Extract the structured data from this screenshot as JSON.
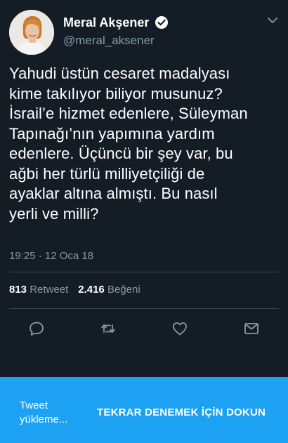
{
  "tweet": {
    "author": {
      "display_name": "Meral Akşener",
      "handle": "@meral_aksener",
      "verified_icon": "verified-badge-icon",
      "avatar": "avatar"
    },
    "body_lines": [
      "Yahudi üstün cesaret madalyası",
      "kime takılıyor biliyor musunuz?",
      "İsrail’e hizmet edenlere, Süleyman",
      "Tapınağı’nın yapımına yardım",
      "edenlere. Üçüncü bir şey var, bu",
      "ağbi her türlü milliyetçiliği de",
      "ayaklar altına almıştı. Bu nasıl",
      "yerli ve milli?"
    ],
    "timestamp": "19:25 · 12 Oca 18",
    "stats": {
      "retweets": "813",
      "retweets_label": "Retweet",
      "likes": "2.416",
      "likes_label": "Beğeni"
    },
    "actions": [
      {
        "name": "reply",
        "icon": "reply-icon"
      },
      {
        "name": "retweet",
        "icon": "retweet-icon"
      },
      {
        "name": "like",
        "icon": "heart-icon"
      },
      {
        "name": "message",
        "icon": "envelope-icon"
      }
    ]
  },
  "banner": {
    "status_lines": [
      "Tweet",
      "yükleme..."
    ],
    "action_label": "TEKRAR DENEMEK İÇİN DOKUN"
  },
  "colors": {
    "background": "#141d26",
    "secondary_text": "#8899a6",
    "divider": "#38444d",
    "accent": "#1da1f2"
  }
}
